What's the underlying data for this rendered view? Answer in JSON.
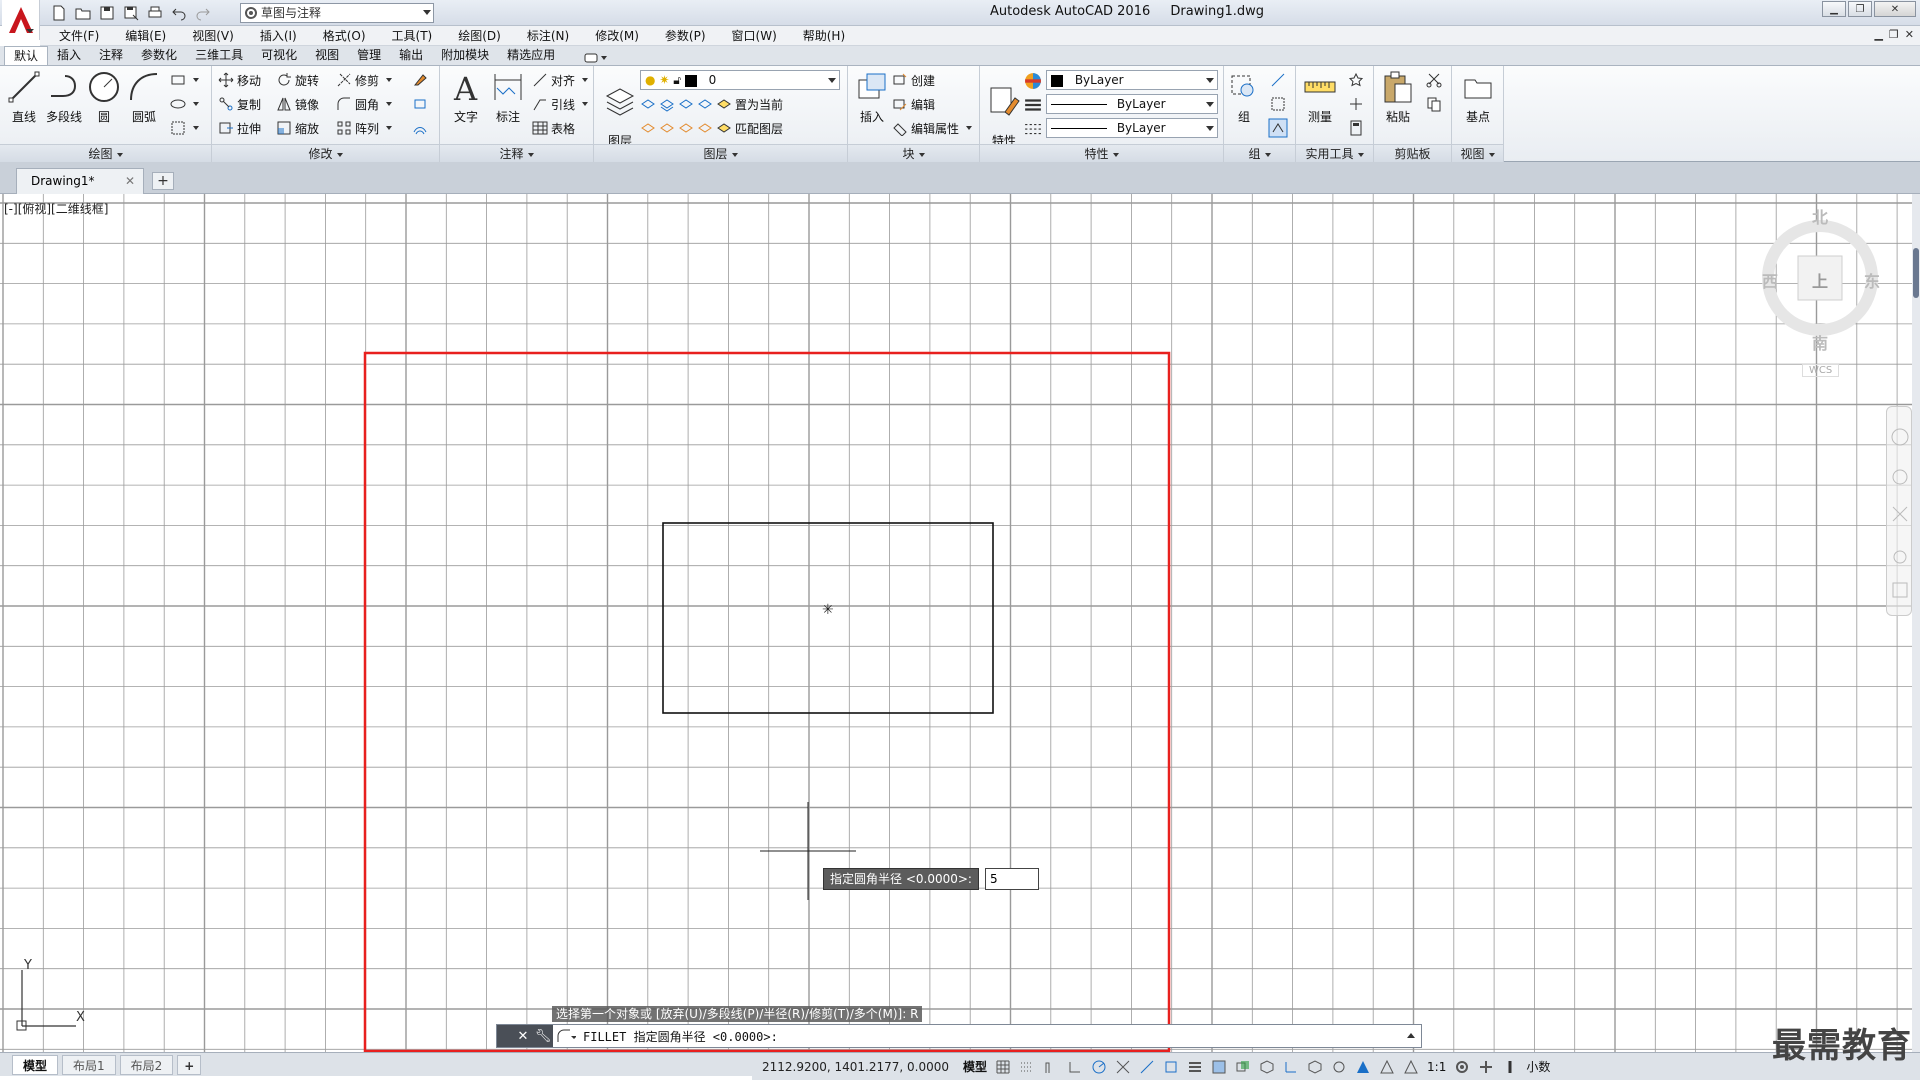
{
  "window": {
    "app_name": "Autodesk AutoCAD 2016",
    "file_name": "Drawing1.dwg"
  },
  "quick_access": {
    "workspace": "草图与注释"
  },
  "menu": [
    "文件(F)",
    "编辑(E)",
    "视图(V)",
    "插入(I)",
    "格式(O)",
    "工具(T)",
    "绘图(D)",
    "标注(N)",
    "修改(M)",
    "参数(P)",
    "窗口(W)",
    "帮助(H)"
  ],
  "ribbon_tabs": [
    "默认",
    "插入",
    "注释",
    "参数化",
    "三维工具",
    "可视化",
    "视图",
    "管理",
    "输出",
    "附加模块",
    "精选应用"
  ],
  "panels": {
    "draw": {
      "title": "绘图",
      "line": "直线",
      "polyline": "多段线",
      "circle": "圆",
      "arc": "圆弧"
    },
    "modify": {
      "title": "修改",
      "move": "移动",
      "rotate": "旋转",
      "trim": "修剪",
      "copy": "复制",
      "mirror": "镜像",
      "fillet": "圆角",
      "stretch": "拉伸",
      "scale": "缩放",
      "array": "阵列"
    },
    "annotation": {
      "title": "注释",
      "text": "文字",
      "dimension": "标注",
      "align": "对齐",
      "leader": "引线",
      "table": "表格"
    },
    "layers": {
      "title": "图层",
      "layer_props": "图层\n特性",
      "layer_value": "0",
      "set_current": "置为当前",
      "match_layer": "匹配图层"
    },
    "block": {
      "title": "块",
      "insert": "插入",
      "create": "创建",
      "edit": "编辑",
      "edit_attr": "编辑属性"
    },
    "properties": {
      "title": "特性",
      "match": "特性\n匹配",
      "color": "ByLayer",
      "linetype": "ByLayer",
      "lineweight": "ByLayer"
    },
    "group": {
      "title": "组",
      "group": "组"
    },
    "utilities": {
      "title": "实用工具",
      "measure": "测量"
    },
    "clipboard": {
      "title": "剪贴板",
      "paste": "粘贴"
    },
    "view": {
      "title": "视图",
      "base": "基点"
    }
  },
  "file_tab": {
    "name": "Drawing1*"
  },
  "viewport": {
    "label": "[-][俯视][二维线框]",
    "compass": {
      "north": "北",
      "south": "南",
      "east": "东",
      "west": "西",
      "face": "上",
      "ucs": "WCS"
    },
    "ucs_y": "Y",
    "ucs_x": "X"
  },
  "dynamic_input": {
    "prompt": "指定圆角半径 <0.0000>:",
    "value": "5"
  },
  "command": {
    "history": "选择第一个对象或 [放弃(U)/多段线(P)/半径(R)/修剪(T)/多个(M)]: R",
    "current": "FILLET 指定圆角半径 <0.0000>:"
  },
  "layout_tabs": [
    "模型",
    "布局1",
    "布局2"
  ],
  "status": {
    "coords": "2112.9200, 1401.2177, 0.0000",
    "model": "模型",
    "scale": "1:1",
    "units": "小数"
  },
  "watermark": "最需教育",
  "colors": {
    "highlight_frame": "#e8201e",
    "grid": "#9a9a9a",
    "accent": "#c8161d"
  }
}
